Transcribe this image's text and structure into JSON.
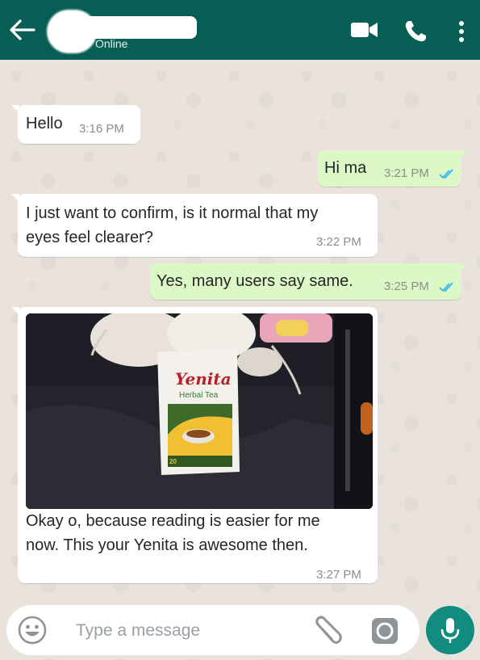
{
  "header": {
    "status": "Online",
    "icons": [
      "back-arrow-icon",
      "video-call-icon",
      "voice-call-icon",
      "more-options-icon"
    ]
  },
  "messages": [
    {
      "direction": "incoming",
      "text": "Hello",
      "time": "3:16 PM"
    },
    {
      "direction": "outgoing",
      "text": "Hi ma",
      "time": "3:21 PM",
      "read": true
    },
    {
      "direction": "incoming",
      "text_lines": [
        "I just want to confirm, is it normal that my",
        "eyes feel clearer?"
      ],
      "time": "3:22 PM"
    },
    {
      "direction": "outgoing",
      "text": "Yes, many users say same.",
      "time": "3:25 PM",
      "read": true
    },
    {
      "direction": "incoming",
      "image": {
        "product_brand": "Yenita",
        "product_name": "Herbal Tea",
        "badge": "20"
      },
      "text_lines": [
        "Okay o, because reading is easier for me",
        "now. This your Yenita is awesome then."
      ],
      "time": "3:27 PM"
    }
  ],
  "composer": {
    "placeholder": "Type a message",
    "icons": [
      "emoji-icon",
      "attach-icon",
      "camera-icon",
      "mic-icon"
    ]
  },
  "colors": {
    "header": "#075e54",
    "outgoing_bubble": "#dcf8c6",
    "incoming_bubble": "#ffffff",
    "mic_button": "#128c7e",
    "read_ticks": "#34b7f1"
  }
}
